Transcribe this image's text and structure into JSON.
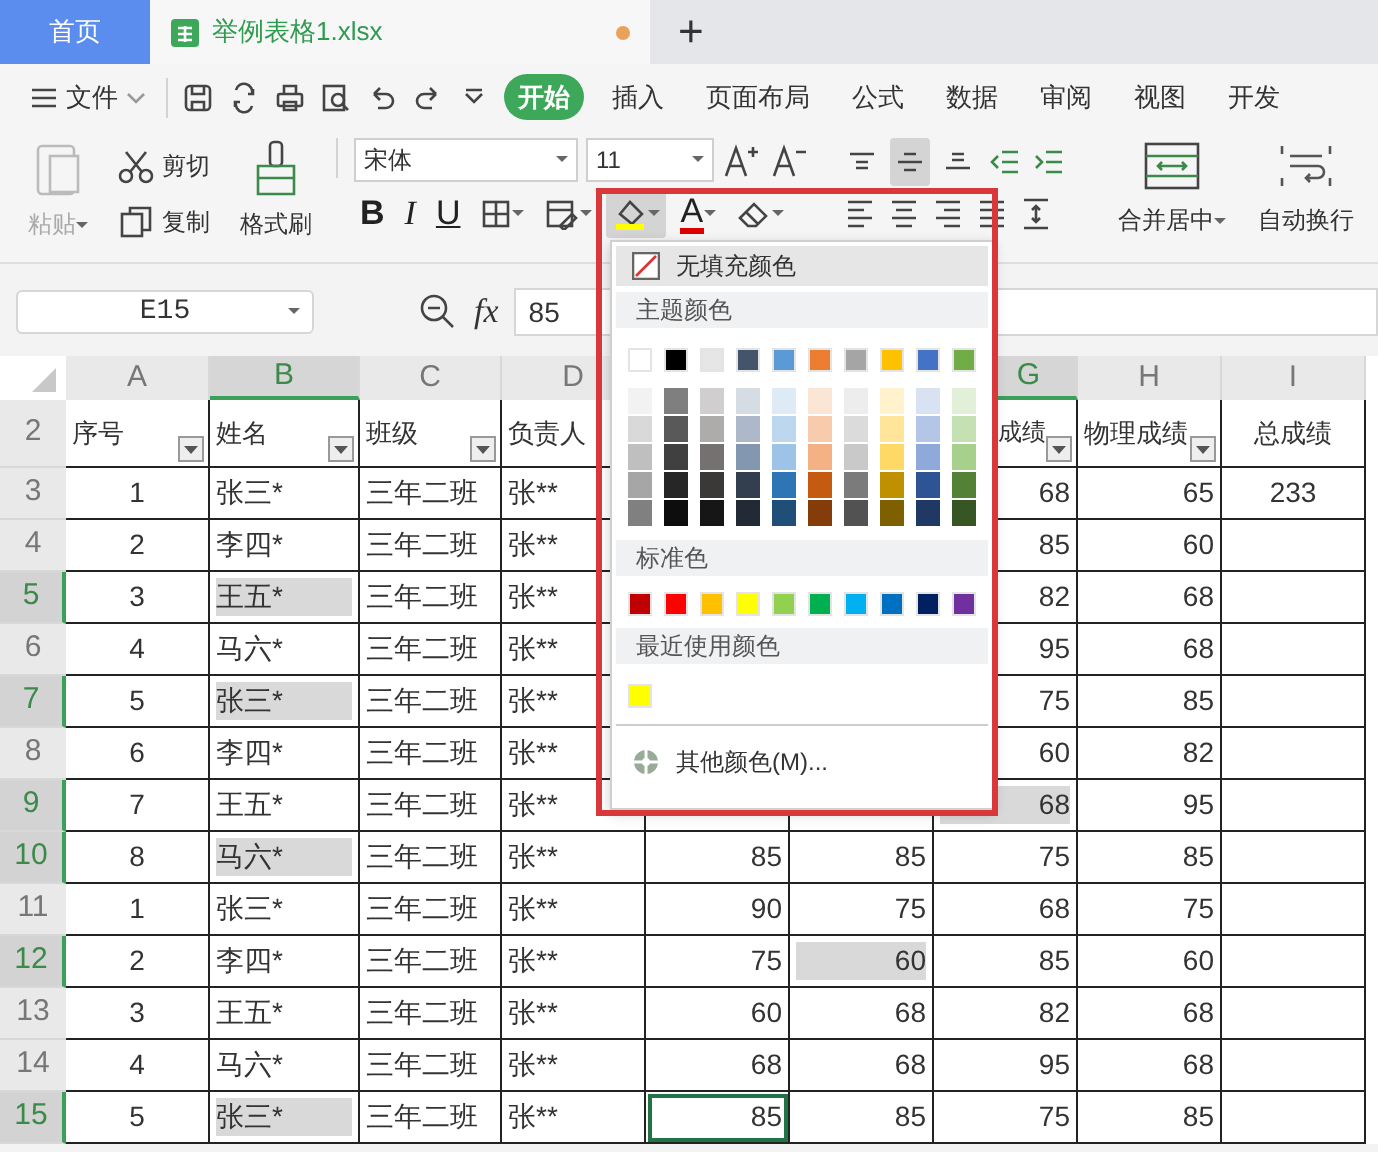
{
  "tabs": [
    {
      "label": "首页",
      "kind": "home",
      "selected": false
    },
    {
      "label": "举例表格1.xlsx",
      "kind": "file",
      "selected": true,
      "unsaved": true
    }
  ],
  "new_tab": "+",
  "menu": {
    "file": "文件",
    "tabs": [
      {
        "label": "开始",
        "selected": true
      },
      {
        "label": "插入",
        "selected": false
      },
      {
        "label": "页面布局",
        "selected": false
      },
      {
        "label": "公式",
        "selected": false
      },
      {
        "label": "数据",
        "selected": false
      },
      {
        "label": "审阅",
        "selected": false
      },
      {
        "label": "视图",
        "selected": false
      },
      {
        "label": "开发",
        "selected": false
      }
    ]
  },
  "ribbon": {
    "paste": {
      "label": "粘贴",
      "disabled": true
    },
    "cut": "剪切",
    "copy": "复制",
    "format_painter": "格式刷",
    "font": "宋体",
    "size": "11",
    "bold": "B",
    "italic": "I",
    "underline": "U",
    "fill_open": true,
    "font_color": "A",
    "vertical_align": [
      {
        "kind": "top",
        "selected": false
      },
      {
        "kind": "middle",
        "selected": true
      },
      {
        "kind": "bottom",
        "selected": false
      }
    ],
    "merge": "合并居中",
    "wrap": "自动换行"
  },
  "formula_bar": {
    "cell": "E15",
    "fx": "fx",
    "value": "85"
  },
  "color_menu": {
    "no_fill": {
      "label": "无填充颜色",
      "highlighted": true
    },
    "theme_label": "主题颜色",
    "theme": [
      {
        "color": "#ffffff"
      },
      {
        "color": "#000000"
      },
      {
        "color": "#e7e6e6"
      },
      {
        "color": "#44546a"
      },
      {
        "color": "#5b9bd5"
      },
      {
        "color": "#ed7d31"
      },
      {
        "color": "#a5a5a5"
      },
      {
        "color": "#ffc000"
      },
      {
        "color": "#4472c4"
      },
      {
        "color": "#70ad47"
      }
    ],
    "shades": [
      [
        {
          "color": "#f2f2f2"
        },
        {
          "color": "#7f7f7f"
        },
        {
          "color": "#d0cece"
        },
        {
          "color": "#d6dce4"
        },
        {
          "color": "#deebf6"
        },
        {
          "color": "#fbe5d5"
        },
        {
          "color": "#ededed"
        },
        {
          "color": "#fff2cc"
        },
        {
          "color": "#d9e2f3"
        },
        {
          "color": "#e2efd9"
        }
      ],
      [
        {
          "color": "#d9d9d9"
        },
        {
          "color": "#595959"
        },
        {
          "color": "#aeabab"
        },
        {
          "color": "#adb9ca"
        },
        {
          "color": "#bdd7ee"
        },
        {
          "color": "#f7cbac"
        },
        {
          "color": "#dbdbdb"
        },
        {
          "color": "#fee599"
        },
        {
          "color": "#b4c6e7"
        },
        {
          "color": "#c5e0b3"
        }
      ],
      [
        {
          "color": "#bfbfbf"
        },
        {
          "color": "#404040"
        },
        {
          "color": "#757171"
        },
        {
          "color": "#8497b0"
        },
        {
          "color": "#9dc3e6"
        },
        {
          "color": "#f4b183"
        },
        {
          "color": "#c9c9c9"
        },
        {
          "color": "#ffd965"
        },
        {
          "color": "#8eaadb"
        },
        {
          "color": "#a8d08d"
        }
      ],
      [
        {
          "color": "#a6a6a6"
        },
        {
          "color": "#262626"
        },
        {
          "color": "#3b3838"
        },
        {
          "color": "#333f4f"
        },
        {
          "color": "#2e75b5"
        },
        {
          "color": "#c55a11"
        },
        {
          "color": "#7b7b7b"
        },
        {
          "color": "#bf9000"
        },
        {
          "color": "#2f5496"
        },
        {
          "color": "#538135"
        }
      ],
      [
        {
          "color": "#808080"
        },
        {
          "color": "#0d0d0d"
        },
        {
          "color": "#171616"
        },
        {
          "color": "#222a35"
        },
        {
          "color": "#1f4e79"
        },
        {
          "color": "#843c0b"
        },
        {
          "color": "#525252"
        },
        {
          "color": "#7f6000"
        },
        {
          "color": "#1f3864"
        },
        {
          "color": "#375623"
        }
      ]
    ],
    "standard_label": "标准色",
    "standard": [
      {
        "color": "#c00000"
      },
      {
        "color": "#ff0000"
      },
      {
        "color": "#ffc000"
      },
      {
        "color": "#ffff00"
      },
      {
        "color": "#92d050"
      },
      {
        "color": "#00b050"
      },
      {
        "color": "#00b0f0"
      },
      {
        "color": "#0070c0"
      },
      {
        "color": "#002060"
      },
      {
        "color": "#7030a0"
      }
    ],
    "recent_label": "最近使用颜色",
    "recent": [
      {
        "color": "#ffff00"
      }
    ],
    "more": {
      "label": "其他颜色(M)...",
      "highlighted": false
    }
  },
  "sheet": {
    "columns": [
      {
        "label": "A",
        "selected": false
      },
      {
        "label": "B",
        "selected": true
      },
      {
        "label": "C",
        "selected": false
      },
      {
        "label": "D",
        "selected": false
      },
      null,
      null,
      {
        "label": "G",
        "selected": true
      },
      {
        "label": "H",
        "selected": false
      },
      {
        "label": "I",
        "selected": false
      }
    ],
    "rows": [
      {
        "label": "2",
        "kind": "header",
        "selected": false,
        "cells": [
          {
            "text": "序号",
            "filter": true
          },
          {
            "text": "姓名",
            "filter": true
          },
          {
            "text": "班级",
            "filter": true
          },
          {
            "text": "负责人",
            "filter": false
          },
          null,
          null,
          {
            "text": "成绩",
            "filter": true
          },
          {
            "text": "物理成绩",
            "filter": true
          },
          {
            "text": "总成绩",
            "filter": false
          }
        ]
      },
      {
        "label": "3",
        "kind": "data",
        "selected": false,
        "cells": [
          {
            "text": "1",
            "filled": false,
            "active": false
          },
          {
            "text": "张三*",
            "filled": false,
            "active": false
          },
          {
            "text": "三年二班",
            "filled": false,
            "active": false
          },
          {
            "text": "张**",
            "filled": false,
            "active": false
          },
          null,
          null,
          {
            "text": "68",
            "filled": false,
            "active": false
          },
          {
            "text": "65",
            "filled": false,
            "active": false
          },
          {
            "text": "233",
            "filled": false,
            "active": false
          }
        ]
      },
      {
        "label": "4",
        "kind": "data",
        "selected": false,
        "cells": [
          {
            "text": "2",
            "filled": false,
            "active": false
          },
          {
            "text": "李四*",
            "filled": false,
            "active": false
          },
          {
            "text": "三年二班",
            "filled": false,
            "active": false
          },
          {
            "text": "张**",
            "filled": false,
            "active": false
          },
          null,
          null,
          {
            "text": "85",
            "filled": false,
            "active": false
          },
          {
            "text": "60",
            "filled": false,
            "active": false
          },
          {
            "filled": false,
            "active": false
          }
        ]
      },
      {
        "label": "5",
        "kind": "data",
        "selected": true,
        "cells": [
          {
            "text": "3",
            "filled": false,
            "active": false
          },
          {
            "text": "王五*",
            "filled": true,
            "active": false
          },
          {
            "text": "三年二班",
            "filled": false,
            "active": false
          },
          {
            "text": "张**",
            "filled": false,
            "active": false
          },
          null,
          null,
          {
            "text": "82",
            "filled": false,
            "active": false
          },
          {
            "text": "68",
            "filled": false,
            "active": false
          },
          {
            "filled": false,
            "active": false
          }
        ]
      },
      {
        "label": "6",
        "kind": "data",
        "selected": false,
        "cells": [
          {
            "text": "4",
            "filled": false,
            "active": false
          },
          {
            "text": "马六*",
            "filled": false,
            "active": false
          },
          {
            "text": "三年二班",
            "filled": false,
            "active": false
          },
          {
            "text": "张**",
            "filled": false,
            "active": false
          },
          null,
          null,
          {
            "text": "95",
            "filled": false,
            "active": false
          },
          {
            "text": "68",
            "filled": false,
            "active": false
          },
          {
            "filled": false,
            "active": false
          }
        ]
      },
      {
        "label": "7",
        "kind": "data",
        "selected": true,
        "cells": [
          {
            "text": "5",
            "filled": false,
            "active": false
          },
          {
            "text": "张三*",
            "filled": true,
            "active": false
          },
          {
            "text": "三年二班",
            "filled": false,
            "active": false
          },
          {
            "text": "张**",
            "filled": false,
            "active": false
          },
          null,
          null,
          {
            "text": "75",
            "filled": false,
            "active": false
          },
          {
            "text": "85",
            "filled": false,
            "active": false
          },
          {
            "filled": false,
            "active": false
          }
        ]
      },
      {
        "label": "8",
        "kind": "data",
        "selected": false,
        "cells": [
          {
            "text": "6",
            "filled": false,
            "active": false
          },
          {
            "text": "李四*",
            "filled": false,
            "active": false
          },
          {
            "text": "三年二班",
            "filled": false,
            "active": false
          },
          {
            "text": "张**",
            "filled": false,
            "active": false
          },
          null,
          null,
          {
            "text": "60",
            "filled": false,
            "active": false
          },
          {
            "text": "82",
            "filled": false,
            "active": false
          },
          {
            "filled": false,
            "active": false
          }
        ]
      },
      {
        "label": "9",
        "kind": "data",
        "selected": true,
        "cells": [
          {
            "text": "7",
            "filled": false,
            "active": false
          },
          {
            "text": "王五*",
            "filled": false,
            "active": false
          },
          {
            "text": "三年二班",
            "filled": false,
            "active": false
          },
          {
            "text": "张**",
            "filled": false,
            "active": false
          },
          null,
          null,
          {
            "text": "68",
            "filled": true,
            "active": false
          },
          {
            "text": "95",
            "filled": false,
            "active": false
          },
          {
            "filled": false,
            "active": false
          }
        ]
      },
      {
        "label": "10",
        "kind": "data",
        "selected": true,
        "cells": [
          {
            "text": "8",
            "filled": false,
            "active": false
          },
          {
            "text": "马六*",
            "filled": true,
            "active": false
          },
          {
            "text": "三年二班",
            "filled": false,
            "active": false
          },
          {
            "text": "张**",
            "filled": false,
            "active": false
          },
          {
            "text": "85",
            "filled": false,
            "active": false
          },
          {
            "text": "85",
            "filled": false,
            "active": false
          },
          {
            "text": "75",
            "filled": false,
            "active": false
          },
          {
            "text": "85",
            "filled": false,
            "active": false
          },
          {
            "filled": false,
            "active": false
          }
        ]
      },
      {
        "label": "11",
        "kind": "data",
        "selected": false,
        "cells": [
          {
            "text": "1",
            "filled": false,
            "active": false
          },
          {
            "text": "张三*",
            "filled": false,
            "active": false
          },
          {
            "text": "三年二班",
            "filled": false,
            "active": false
          },
          {
            "text": "张**",
            "filled": false,
            "active": false
          },
          {
            "text": "90",
            "filled": false,
            "active": false
          },
          {
            "text": "75",
            "filled": false,
            "active": false
          },
          {
            "text": "68",
            "filled": false,
            "active": false
          },
          {
            "text": "75",
            "filled": false,
            "active": false
          },
          {
            "filled": false,
            "active": false
          }
        ]
      },
      {
        "label": "12",
        "kind": "data",
        "selected": true,
        "cells": [
          {
            "text": "2",
            "filled": false,
            "active": false
          },
          {
            "text": "李四*",
            "filled": false,
            "active": false
          },
          {
            "text": "三年二班",
            "filled": false,
            "active": false
          },
          {
            "text": "张**",
            "filled": false,
            "active": false
          },
          {
            "text": "75",
            "filled": false,
            "active": false
          },
          {
            "text": "60",
            "filled": true,
            "active": false
          },
          {
            "text": "85",
            "filled": false,
            "active": false
          },
          {
            "text": "60",
            "filled": false,
            "active": false
          },
          {
            "filled": false,
            "active": false
          }
        ]
      },
      {
        "label": "13",
        "kind": "data",
        "selected": false,
        "cells": [
          {
            "text": "3",
            "filled": false,
            "active": false
          },
          {
            "text": "王五*",
            "filled": false,
            "active": false
          },
          {
            "text": "三年二班",
            "filled": false,
            "active": false
          },
          {
            "text": "张**",
            "filled": false,
            "active": false
          },
          {
            "text": "60",
            "filled": false,
            "active": false
          },
          {
            "text": "68",
            "filled": false,
            "active": false
          },
          {
            "text": "82",
            "filled": false,
            "active": false
          },
          {
            "text": "68",
            "filled": false,
            "active": false
          },
          {
            "filled": false,
            "active": false
          }
        ]
      },
      {
        "label": "14",
        "kind": "data",
        "selected": false,
        "cells": [
          {
            "text": "4",
            "filled": false,
            "active": false
          },
          {
            "text": "马六*",
            "filled": false,
            "active": false
          },
          {
            "text": "三年二班",
            "filled": false,
            "active": false
          },
          {
            "text": "张**",
            "filled": false,
            "active": false
          },
          {
            "text": "68",
            "filled": false,
            "active": false
          },
          {
            "text": "68",
            "filled": false,
            "active": false
          },
          {
            "text": "95",
            "filled": false,
            "active": false
          },
          {
            "text": "68",
            "filled": false,
            "active": false
          },
          {
            "filled": false,
            "active": false
          }
        ]
      },
      {
        "label": "15",
        "kind": "data",
        "selected": true,
        "cells": [
          {
            "text": "5",
            "filled": false,
            "active": false
          },
          {
            "text": "张三*",
            "filled": true,
            "active": false
          },
          {
            "text": "三年二班",
            "filled": false,
            "active": false
          },
          {
            "text": "张**",
            "filled": false,
            "active": false
          },
          {
            "text": "85",
            "filled": false,
            "active": true
          },
          {
            "text": "85",
            "filled": false,
            "active": false
          },
          {
            "text": "75",
            "filled": false,
            "active": false
          },
          {
            "text": "85",
            "filled": false,
            "active": false
          },
          {
            "filled": false,
            "active": false
          }
        ]
      }
    ]
  }
}
